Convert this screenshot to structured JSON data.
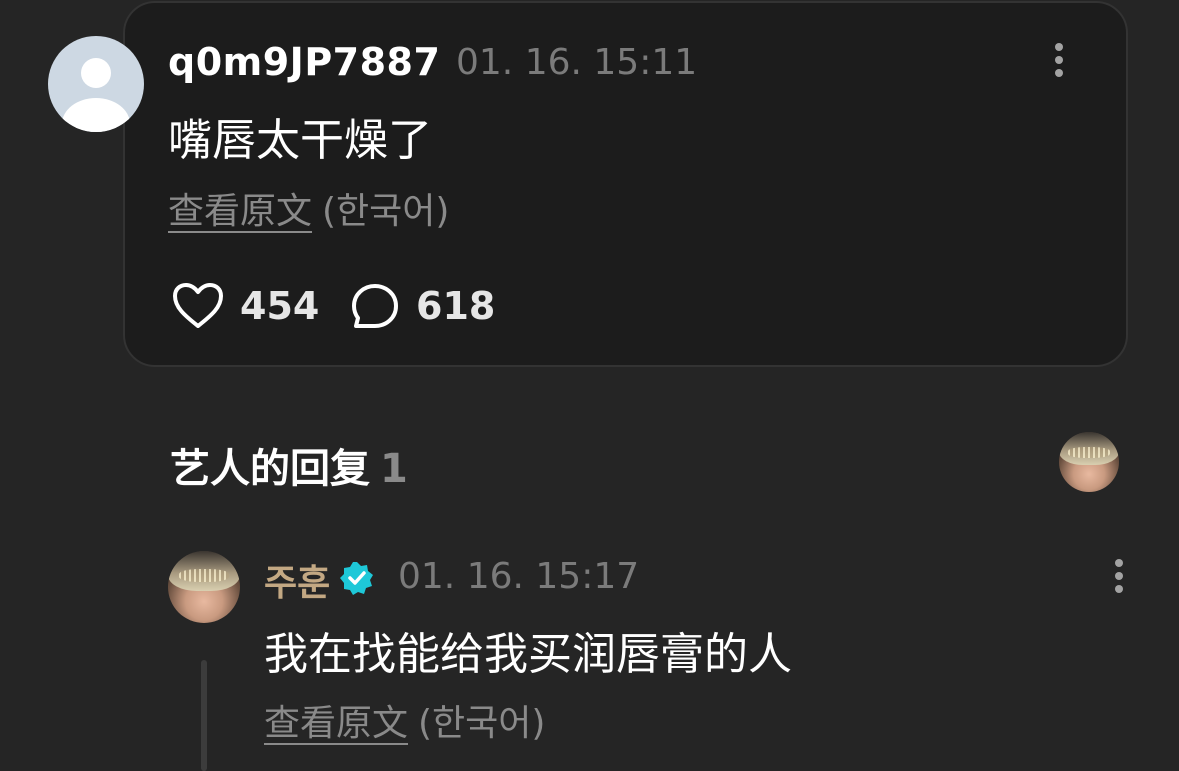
{
  "comment": {
    "username": "q0m9JP7887",
    "timestamp": "01. 16. 15:11",
    "text": "嘴唇太干燥了",
    "see_original": "查看原文",
    "language": "(한국어)",
    "likes": "454",
    "replies": "618"
  },
  "artist_replies": {
    "title": "艺人的回复",
    "count": "1"
  },
  "reply": {
    "author": "주훈",
    "verified": true,
    "timestamp": "01. 16. 15:17",
    "text": "我在找能给我买润唇膏的人",
    "see_original": "查看原文",
    "language": "(한국어)"
  },
  "colors": {
    "background": "#252525",
    "card": "#1c1c1c",
    "artist_name": "#c3a883",
    "verified_badge": "#1ec8d8",
    "muted_text": "#7b7b7b"
  },
  "icons": {
    "like": "heart-icon",
    "reply": "speech-bubble-icon",
    "more": "more-vertical-icon",
    "verified": "verified-badge-icon"
  }
}
